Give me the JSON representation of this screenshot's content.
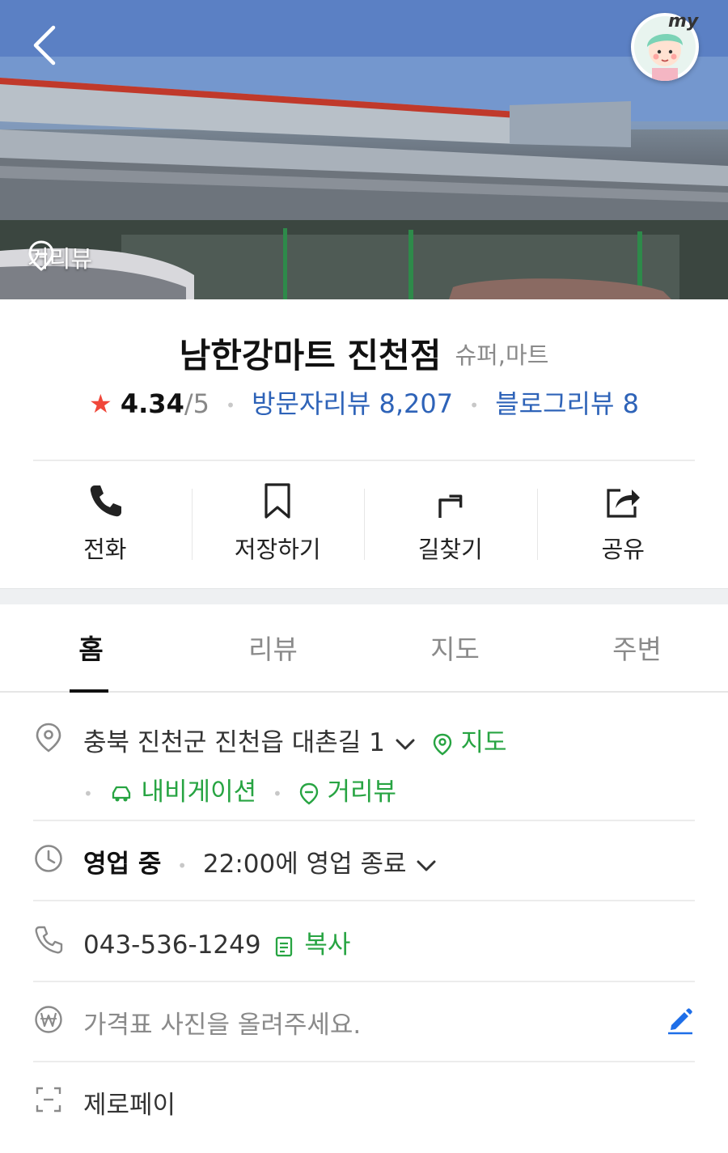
{
  "header": {
    "back_icon": "chevron-left-icon",
    "my_badge": "my",
    "streetview_label": "거리뷰"
  },
  "place": {
    "name": "남한강마트 진천점",
    "category": "슈퍼,마트",
    "rating_score": "4.34",
    "rating_max": "/5",
    "visitor_reviews": "방문자리뷰 8,207",
    "blog_reviews": "블로그리뷰 8"
  },
  "actions": [
    {
      "label": "전화",
      "icon": "phone-icon"
    },
    {
      "label": "저장하기",
      "icon": "bookmark-icon"
    },
    {
      "label": "길찾기",
      "icon": "directions-icon"
    },
    {
      "label": "공유",
      "icon": "share-icon"
    }
  ],
  "tabs": [
    {
      "label": "홈",
      "active": true
    },
    {
      "label": "리뷰",
      "active": false
    },
    {
      "label": "지도",
      "active": false
    },
    {
      "label": "주변",
      "active": false
    }
  ],
  "info": {
    "address": "충북 진천군 진천읍 대촌길 1",
    "map_link": "지도",
    "navigation_link": "내비게이션",
    "streetview_link": "거리뷰",
    "hours_status": "영업 중",
    "hours_detail": "22:00에 영업 종료",
    "phone": "043-536-1249",
    "copy_label": "복사",
    "price_placeholder": "가격표 사진을 올려주세요.",
    "zeropay": "제로페이"
  },
  "colors": {
    "accent_blue": "#2e63b8",
    "accent_green": "#27a442",
    "star_red": "#f0473a",
    "edit_blue": "#1e6ee8"
  }
}
